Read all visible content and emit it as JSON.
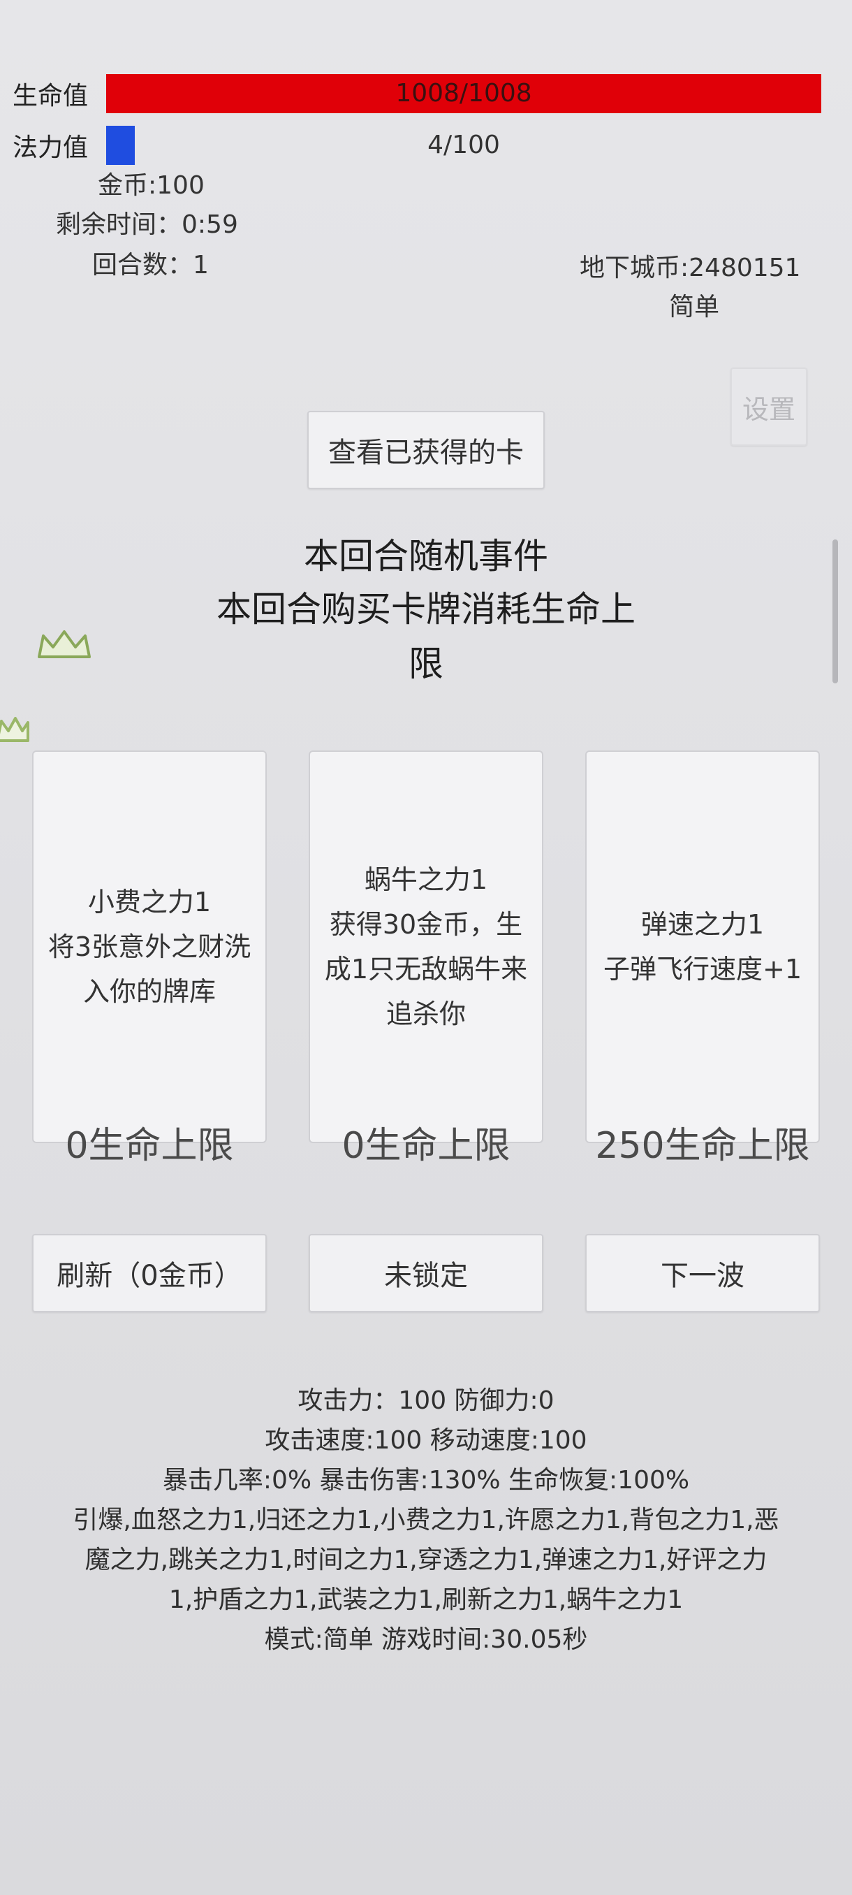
{
  "hud": {
    "hp_label": "生命值",
    "hp_value": "1008/1008",
    "hp_fraction": 1.0,
    "mp_label": "法力值",
    "mp_value": "4/100",
    "mp_fraction": 0.04,
    "gold": "金币:100",
    "time_left": "剩余时间：0:59",
    "round": "回合数：1",
    "dungeon_coins": "地下城币:2480151",
    "difficulty": "简单",
    "settings_label": "设置"
  },
  "view_cards_label": "查看已获得的卡",
  "event": {
    "title": "本回合随机事件",
    "line1": "本回合购买卡牌消耗生命上",
    "line2": "限"
  },
  "cards": [
    {
      "desc": "小费之力1\n将3张意外之财洗\n入你的牌库",
      "cost": "0生命上限"
    },
    {
      "desc": "蜗牛之力1\n获得30金币，生\n成1只无敌蜗牛来\n追杀你",
      "cost": "0生命上限"
    },
    {
      "desc": "弹速之力1\n子弹飞行速度+1",
      "cost": "250生命上限"
    }
  ],
  "actions": {
    "refresh": "刷新（0金币）",
    "lock": "未锁定",
    "next_wave": "下一波"
  },
  "stats": {
    "line1": "攻击力：100 防御力:0",
    "line2": "攻击速度:100 移动速度:100",
    "line3": "暴击几率:0% 暴击伤害:130% 生命恢复:100%",
    "line4": "引爆,血怒之力1,归还之力1,小费之力1,许愿之力1,背包之力1,恶",
    "line5": "魔之力,跳关之力1,时间之力1,穿透之力1,弹速之力1,好评之力",
    "line6": "1,护盾之力1,武装之力1,刷新之力1,蜗牛之力1",
    "line7": "模式:简单 游戏时间:30.05秒"
  },
  "colors": {
    "hp": "#e00008",
    "mp": "#1f4de0",
    "background": "#e2e2e5"
  }
}
